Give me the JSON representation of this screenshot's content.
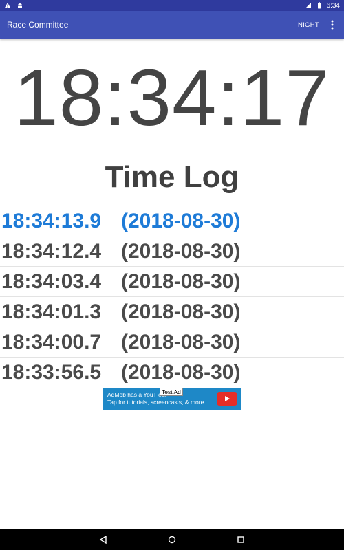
{
  "status_bar": {
    "time": "6:34",
    "icons": [
      "warning-icon",
      "android-icon",
      "lte-signal-icon",
      "battery-icon"
    ]
  },
  "app_bar": {
    "title": "Race Committee",
    "night_label": "NIGHT",
    "overflow_icon": "more-vert-icon"
  },
  "clock": {
    "time": "18:34:17"
  },
  "log": {
    "title": "Time Log",
    "entries": [
      {
        "time": "18:34:13.9",
        "date": "(2018-08-30)"
      },
      {
        "time": "18:34:12.4",
        "date": "(2018-08-30)"
      },
      {
        "time": "18:34:03.4",
        "date": "(2018-08-30)"
      },
      {
        "time": "18:34:01.3",
        "date": "(2018-08-30)"
      },
      {
        "time": "18:34:00.7",
        "date": "(2018-08-30)"
      },
      {
        "time": "18:33:56.5",
        "date": "(2018-08-30)"
      }
    ]
  },
  "ad": {
    "label": "Test Ad",
    "line1": "AdMob has a YouT      es!",
    "line2": "Tap for tutorials, screencasts, & more.",
    "icon": "youtube-play-icon"
  },
  "nav_bar": {
    "icons": [
      "back-icon",
      "home-icon",
      "recents-icon"
    ]
  },
  "colors": {
    "primary": "#3f51b5",
    "primary_dark": "#2f3a9e",
    "highlight": "#1e7bd7",
    "text": "#4a4a4a"
  }
}
